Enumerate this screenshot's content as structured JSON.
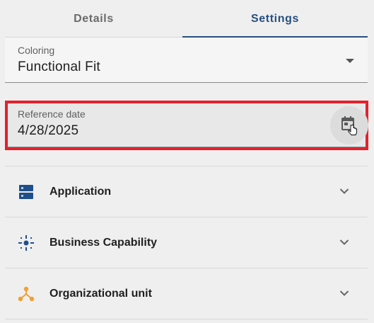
{
  "tabs": [
    {
      "label": "Details",
      "active": false
    },
    {
      "label": "Settings",
      "active": true
    }
  ],
  "coloring": {
    "label": "Coloring",
    "value": "Functional Fit"
  },
  "reference_date": {
    "label": "Reference date",
    "value": "4/28/2025",
    "highlight_color": "#e3212b"
  },
  "sections": [
    {
      "label": "Application",
      "icon": "application-icon",
      "color": "#1f4e8c"
    },
    {
      "label": "Business Capability",
      "icon": "business-capability-icon",
      "color": "#1f4e8c"
    },
    {
      "label": "Organizational unit",
      "icon": "organizational-unit-icon",
      "color": "#f0a035"
    }
  ],
  "colors": {
    "accent": "#27507f",
    "inactive_tab": "#6b6b6b",
    "background": "#efefef"
  }
}
